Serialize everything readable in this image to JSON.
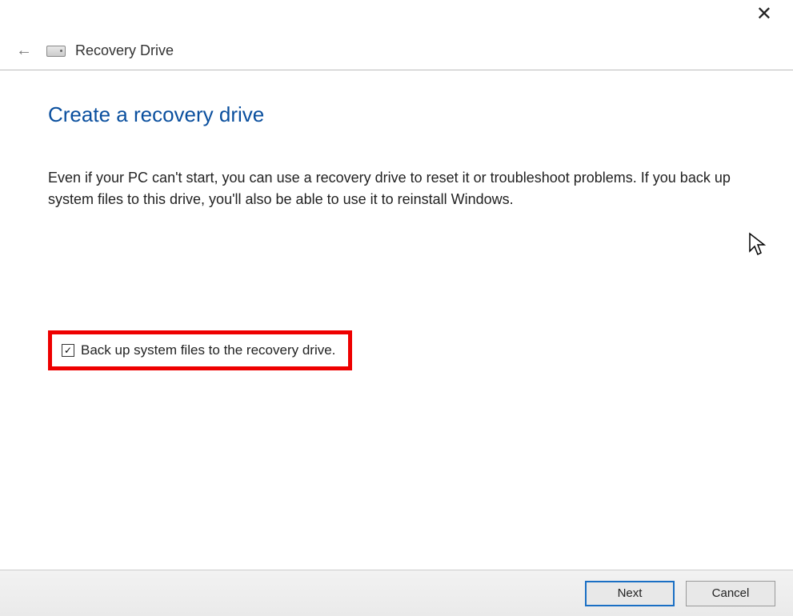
{
  "titlebar": {
    "close_glyph": "✕"
  },
  "header": {
    "back_glyph": "←",
    "title": "Recovery Drive"
  },
  "main": {
    "heading": "Create a recovery drive",
    "description": "Even if your PC can't start, you can use a recovery drive to reset it or troubleshoot problems. If you back up system files to this drive, you'll also be able to use it to reinstall Windows.",
    "checkbox": {
      "checked_glyph": "✓",
      "label": "Back up system files to the recovery drive.",
      "checked": true
    }
  },
  "footer": {
    "next_label": "Next",
    "cancel_label": "Cancel"
  }
}
